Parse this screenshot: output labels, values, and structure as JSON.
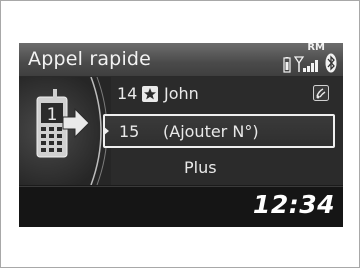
{
  "screen": {
    "title": "Appel rapide",
    "status_icons": [
      "phone-battery-icon",
      "signal-strength-icon",
      "bluetooth-icon"
    ],
    "roaming_label": "RM",
    "clock": "12:34"
  },
  "speed_dial": {
    "items": [
      {
        "number": "14",
        "icon": "star-icon",
        "name": "John",
        "voice_tag": "voice-tag-icon"
      },
      {
        "number": "15",
        "label": "(Ajouter N°)",
        "selected": true
      },
      {
        "label": "Plus"
      }
    ]
  },
  "colors": {
    "screen_bg": "#1b1b1b",
    "titlebar": "#555555",
    "text": "#e9e9e9",
    "selection_border": "#efefef"
  }
}
